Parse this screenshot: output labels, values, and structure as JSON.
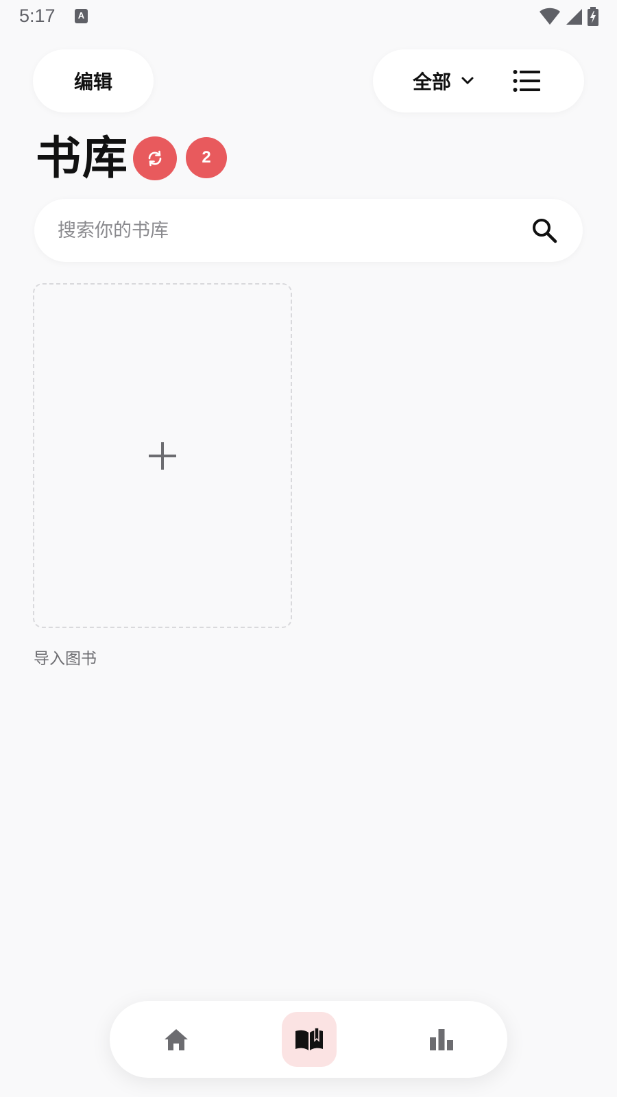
{
  "status_bar": {
    "time": "5:17",
    "notification_icon": "A"
  },
  "toolbar": {
    "edit_label": "编辑",
    "filter": {
      "selected": "全部",
      "icon": "chevron-down-icon"
    },
    "view_toggle_icon": "list-icon"
  },
  "header": {
    "title": "书库",
    "sync_icon": "sync-icon",
    "badge_count": "2",
    "accent_color": "#e85a5d"
  },
  "search": {
    "placeholder": "搜索你的书库",
    "value": ""
  },
  "library": {
    "import_card": {
      "icon": "plus-icon",
      "label": "导入图书"
    }
  },
  "bottom_nav": {
    "items": [
      {
        "name": "home",
        "icon": "home-icon",
        "active": false
      },
      {
        "name": "library",
        "icon": "open-book-icon",
        "active": true
      },
      {
        "name": "stats",
        "icon": "bar-chart-icon",
        "active": false
      }
    ],
    "active_bg": "#fbe3e3"
  }
}
